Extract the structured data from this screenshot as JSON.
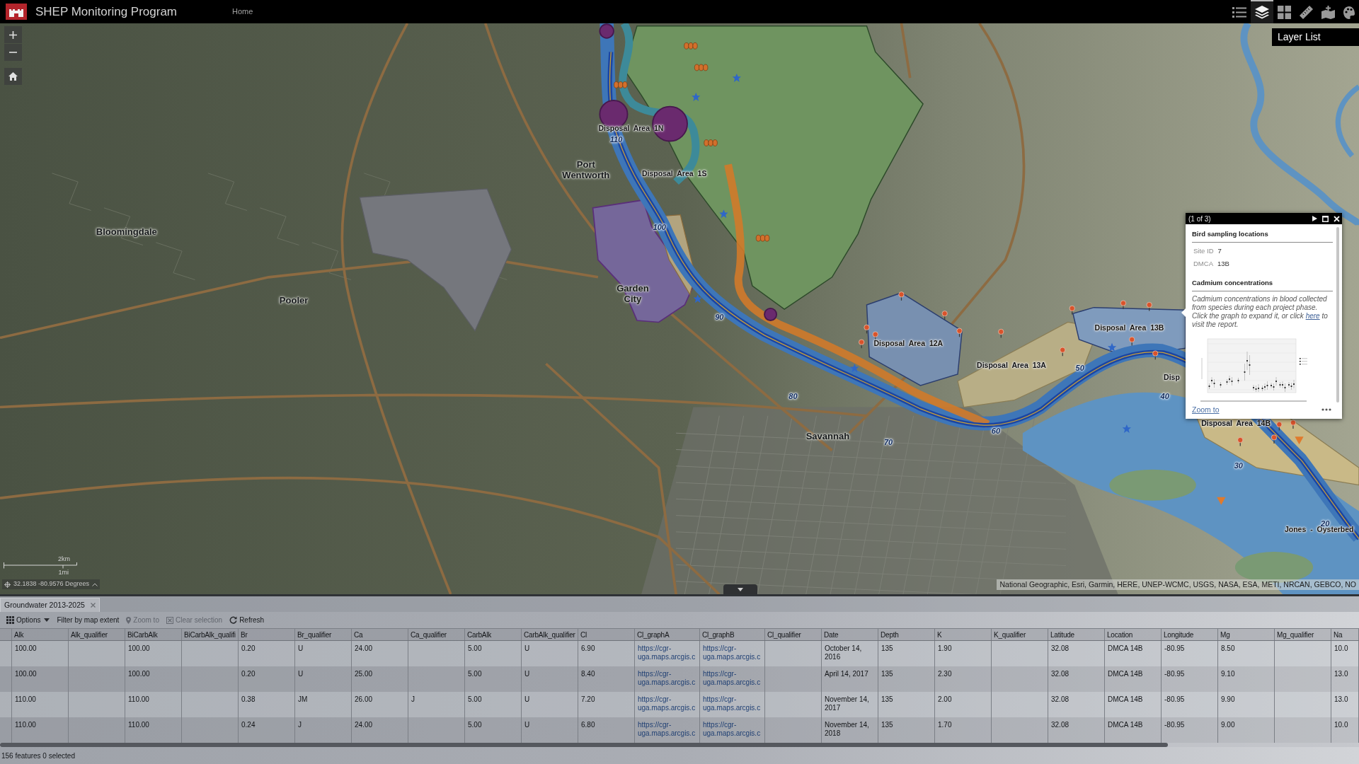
{
  "header": {
    "title": "SHEP Monitoring Program",
    "nav": [
      {
        "label": "Home"
      }
    ],
    "tools": [
      {
        "selected": false
      },
      {
        "selected": true
      },
      {
        "selected": false
      },
      {
        "selected": false
      },
      {
        "selected": false
      },
      {
        "selected": false
      }
    ]
  },
  "layer_list": {
    "title": "Layer List"
  },
  "map": {
    "places": [
      {
        "name": "Bloomingdale"
      },
      {
        "name": "Pooler"
      },
      {
        "name": "Port Wentworth"
      },
      {
        "name": "Garden City"
      },
      {
        "name": "Savannah"
      }
    ],
    "disposal_areas": [
      {
        "label": "Disposal Area 1N"
      },
      {
        "label": "Disposal Area 1S"
      },
      {
        "label": "Disposal Area 12A"
      },
      {
        "label": "Disposal Area 13A"
      },
      {
        "label": "Disposal Area 13B"
      },
      {
        "label": "Disp"
      },
      {
        "label": "Disposal Area 14B"
      },
      {
        "label": "Jones - Oysterbed"
      }
    ],
    "channel_markers": [
      "110",
      "100",
      "90",
      "80",
      "70",
      "60",
      "50",
      "40",
      "30",
      "20"
    ],
    "scale": {
      "metric": "2km",
      "imperial": "1mi"
    },
    "coordinates": "32.1838 -80.9576 Degrees",
    "attribution": "National Geographic, Esri, Garmin, HERE, UNEP-WCMC, USGS, NASA, ESA, METI, NRCAN, GEBCO, NO"
  },
  "popup": {
    "pager": "(1 of 3)",
    "title": "Bird sampling locations",
    "fields": [
      {
        "label": "Site ID",
        "value": "7"
      },
      {
        "label": "DMCA",
        "value": "13B"
      }
    ],
    "section_title": "Cadmium concentrations",
    "description": {
      "before": "Cadmium concentrations in blood collected from species during each project phase. Click the graph to expand it, or click",
      "link": "here",
      "after": "to visit the report."
    },
    "footer_link": "Zoom to"
  },
  "table": {
    "tabs": [
      {
        "label": "Groundwater 2013-2025",
        "selected": true
      }
    ],
    "toolbar": [
      {
        "kind": "menu",
        "label": "Options",
        "disabled": false
      },
      {
        "kind": "filter",
        "label": "Filter by map extent",
        "disabled": false
      },
      {
        "kind": "zoom",
        "label": "Zoom to",
        "disabled": true
      },
      {
        "kind": "clear",
        "label": "Clear selection",
        "disabled": true
      },
      {
        "kind": "refresh",
        "label": "Refresh",
        "disabled": false
      }
    ],
    "columns": [
      {
        "label": "Alk",
        "kind": "text"
      },
      {
        "label": "Alk_qualifier",
        "kind": "text"
      },
      {
        "label": "BiCarbAlk",
        "kind": "text"
      },
      {
        "label": "BiCarbAlk_qualifi",
        "kind": "text"
      },
      {
        "label": "Br",
        "kind": "text"
      },
      {
        "label": "Br_qualifier",
        "kind": "text"
      },
      {
        "label": "Ca",
        "kind": "text"
      },
      {
        "label": "Ca_qualifier",
        "kind": "text"
      },
      {
        "label": "CarbAlk",
        "kind": "text"
      },
      {
        "label": "CarbAlk_qualifier",
        "kind": "text"
      },
      {
        "label": "Cl",
        "kind": "text"
      },
      {
        "label": "Cl_graphA",
        "kind": "link"
      },
      {
        "label": "Cl_graphB",
        "kind": "link"
      },
      {
        "label": "Cl_qualifier",
        "kind": "text"
      },
      {
        "label": "Date",
        "kind": "text"
      },
      {
        "label": "Depth",
        "kind": "text"
      },
      {
        "label": "K",
        "kind": "text"
      },
      {
        "label": "K_qualifier",
        "kind": "text"
      },
      {
        "label": "Latitude",
        "kind": "text"
      },
      {
        "label": "Location",
        "kind": "text"
      },
      {
        "label": "Longitude",
        "kind": "text"
      },
      {
        "label": "Mg",
        "kind": "text"
      },
      {
        "label": "Mg_qualifier",
        "kind": "text"
      },
      {
        "label": "Na",
        "kind": "text"
      }
    ],
    "rows": [
      [
        "100.00",
        null,
        "100.00",
        null,
        "0.20",
        "U",
        "24.00",
        null,
        "5.00",
        "U",
        "6.90",
        "https://cgr-uga.maps.arcgis.c",
        "https://cgr-uga.maps.arcgis.c",
        null,
        "October 14, 2016",
        "135",
        "1.90",
        null,
        "32.08",
        "DMCA 14B",
        "-80.95",
        "8.50",
        null,
        "10.0"
      ],
      [
        "100.00",
        null,
        "100.00",
        null,
        "0.20",
        "U",
        "25.00",
        null,
        "5.00",
        "U",
        "8.40",
        "https://cgr-uga.maps.arcgis.c",
        "https://cgr-uga.maps.arcgis.c",
        null,
        "April 14, 2017",
        "135",
        "2.30",
        null,
        "32.08",
        "DMCA 14B",
        "-80.95",
        "9.10",
        null,
        "13.0"
      ],
      [
        "110.00",
        null,
        "110.00",
        null,
        "0.38",
        "JM",
        "26.00",
        "J",
        "5.00",
        "U",
        "7.20",
        "https://cgr-uga.maps.arcgis.c",
        "https://cgr-uga.maps.arcgis.c",
        null,
        "November 14, 2017",
        "135",
        "2.00",
        null,
        "32.08",
        "DMCA 14B",
        "-80.95",
        "9.90",
        null,
        "13.0"
      ],
      [
        "110.00",
        null,
        "110.00",
        null,
        "0.24",
        "J",
        "24.00",
        null,
        "5.00",
        "U",
        "6.80",
        "https://cgr-uga.maps.arcgis.c",
        "https://cgr-uga.maps.arcgis.c",
        null,
        "November 14, 2018",
        "135",
        "1.70",
        null,
        "32.08",
        "DMCA 14B",
        "-80.95",
        "9.00",
        null,
        "10.0"
      ]
    ],
    "status": "156 features 0 selected"
  }
}
